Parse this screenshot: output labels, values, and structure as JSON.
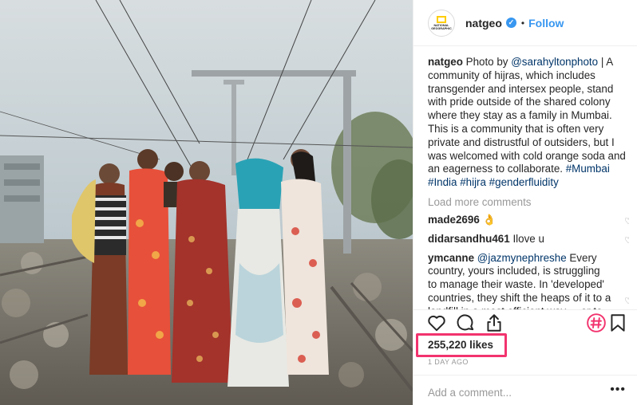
{
  "post": {
    "photo_description_icon": "photo",
    "header": {
      "username": "natgeo",
      "avatar_text": [
        "NATIONAL",
        "GEOGRAPHIC"
      ],
      "verified_icon": "verified-badge-icon",
      "separator": "•",
      "follow_label": "Follow"
    },
    "caption": {
      "username": "natgeo",
      "text_before": "Photo by ",
      "mention": "@sarahyltonphoto",
      "text_after": " | A community of hijras, which includes transgender and intersex people, stand with pride outside of the shared colony where they stay as a family in Mumbai. This is a community that is often very private and distrustful of outsiders, but I was welcomed with cold orange soda and an eagerness to collaborate. ",
      "hashtags": "#Mumbai #India #hijra #genderfluidity"
    },
    "load_more": "Load more comments",
    "comments": [
      {
        "username": "made2696",
        "text": "👌"
      },
      {
        "username": "didarsandhu461",
        "text": "Ilove u"
      },
      {
        "username": "ymcanne",
        "mention": "@jazmynephreshe",
        "text": " Every country, yours included, is struggling to manage their waste. In 'developed' countries, they shift the heaps of it to a landfill in a most efficient way ... or to an industrial facility, where people don't"
      }
    ],
    "actions": {
      "like_icon": "heart-icon",
      "comment_icon": "comment-icon",
      "share_icon": "share-icon",
      "hashtag_icon": "hashtag-icon",
      "save_icon": "bookmark-icon"
    },
    "likes": "255,220 likes",
    "time": "1 DAY AGO",
    "add_comment_placeholder": "Add a comment...",
    "more_label": "•••"
  },
  "colors": {
    "accent_blue": "#3897f0",
    "highlight_pink": "#f2336e",
    "muted_gray": "#999999"
  }
}
